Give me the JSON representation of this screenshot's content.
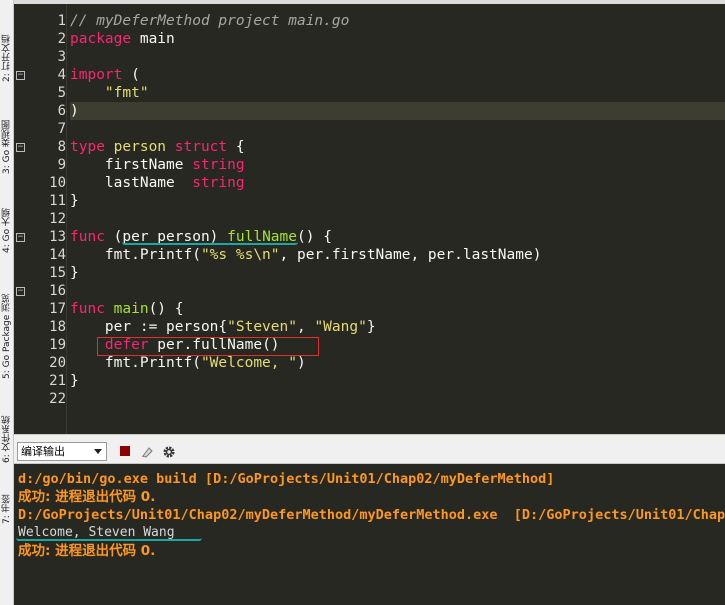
{
  "side_tabs": [
    {
      "label": "2: 打开文档"
    },
    {
      "label": "3: Go 类视图"
    },
    {
      "label": "4: Go 大纲"
    },
    {
      "label": "5: Go Package 浏览"
    },
    {
      "label": "6: 文件系统"
    },
    {
      "label": "7: 书签"
    }
  ],
  "editor": {
    "line_numbers": [
      "1",
      "2",
      "3",
      "4",
      "5",
      "6",
      "7",
      "8",
      "9",
      "10",
      "11",
      "12",
      "13",
      "14",
      "15",
      "16",
      "17",
      "18",
      "19",
      "20",
      "21",
      "22"
    ],
    "fold_markers": [
      "−",
      "−",
      "−",
      "−"
    ],
    "current_line": "6",
    "lines": {
      "l1": "// myDeferMethod project main.go",
      "l2_kw": "package",
      "l2_rest": " main",
      "l4_kw": "import",
      "l4_rest": " (",
      "l5": "    \"fmt\"",
      "l6": ")",
      "l8_kw": "type",
      "l8_name": " person",
      "l8_kw2": " struct",
      "l8_rest": " {",
      "l9_name": "    firstName",
      "l9_type": " string",
      "l10_name": "    lastName",
      "l10_type": "  string",
      "l11": "}",
      "l13_kw": "func",
      "l13_mid": " (per person)",
      "l13_fn": " fullName",
      "l13_rest": "() {",
      "l14_pre": "    fmt.Printf(",
      "l14_str": "\"%s %s\\n\"",
      "l14_rest": ", per.firstName, per.lastName)",
      "l15": "}",
      "l17_kw": "func",
      "l17_fn": " main",
      "l17_rest": "() {",
      "l18_pre": "    per := person{",
      "l18_s1": "\"Steven\"",
      "l18_mid": ", ",
      "l18_s2": "\"Wang\"",
      "l18_rest": "}",
      "l19_kw": "    defer",
      "l19_rest": " per.fullName()",
      "l20_pre": "    fmt.Printf(",
      "l20_str": "\"Welcome, \"",
      "l20_rest": ")",
      "l21": "}"
    }
  },
  "toolbar": {
    "output_select": "编译输出"
  },
  "output": {
    "lines": [
      "d:/go/bin/go.exe build [D:/GoProjects/Unit01/Chap02/myDeferMethod]",
      "成功: 进程退出代码 0.",
      "D:/GoProjects/Unit01/Chap02/myDeferMethod/myDeferMethod.exe  [D:/GoProjects/Unit01/Chap02/myDeferMethod]",
      "Welcome, Steven Wang",
      "成功: 进程退出代码 0."
    ]
  },
  "colors": {
    "editor_bg": "#272822",
    "keyword": "#f92672",
    "type": "#e6db74",
    "function": "#a6e22e",
    "output_text": "#fd971f",
    "highlight_box": "#e0302a",
    "squiggle": "#1fa6a0"
  }
}
